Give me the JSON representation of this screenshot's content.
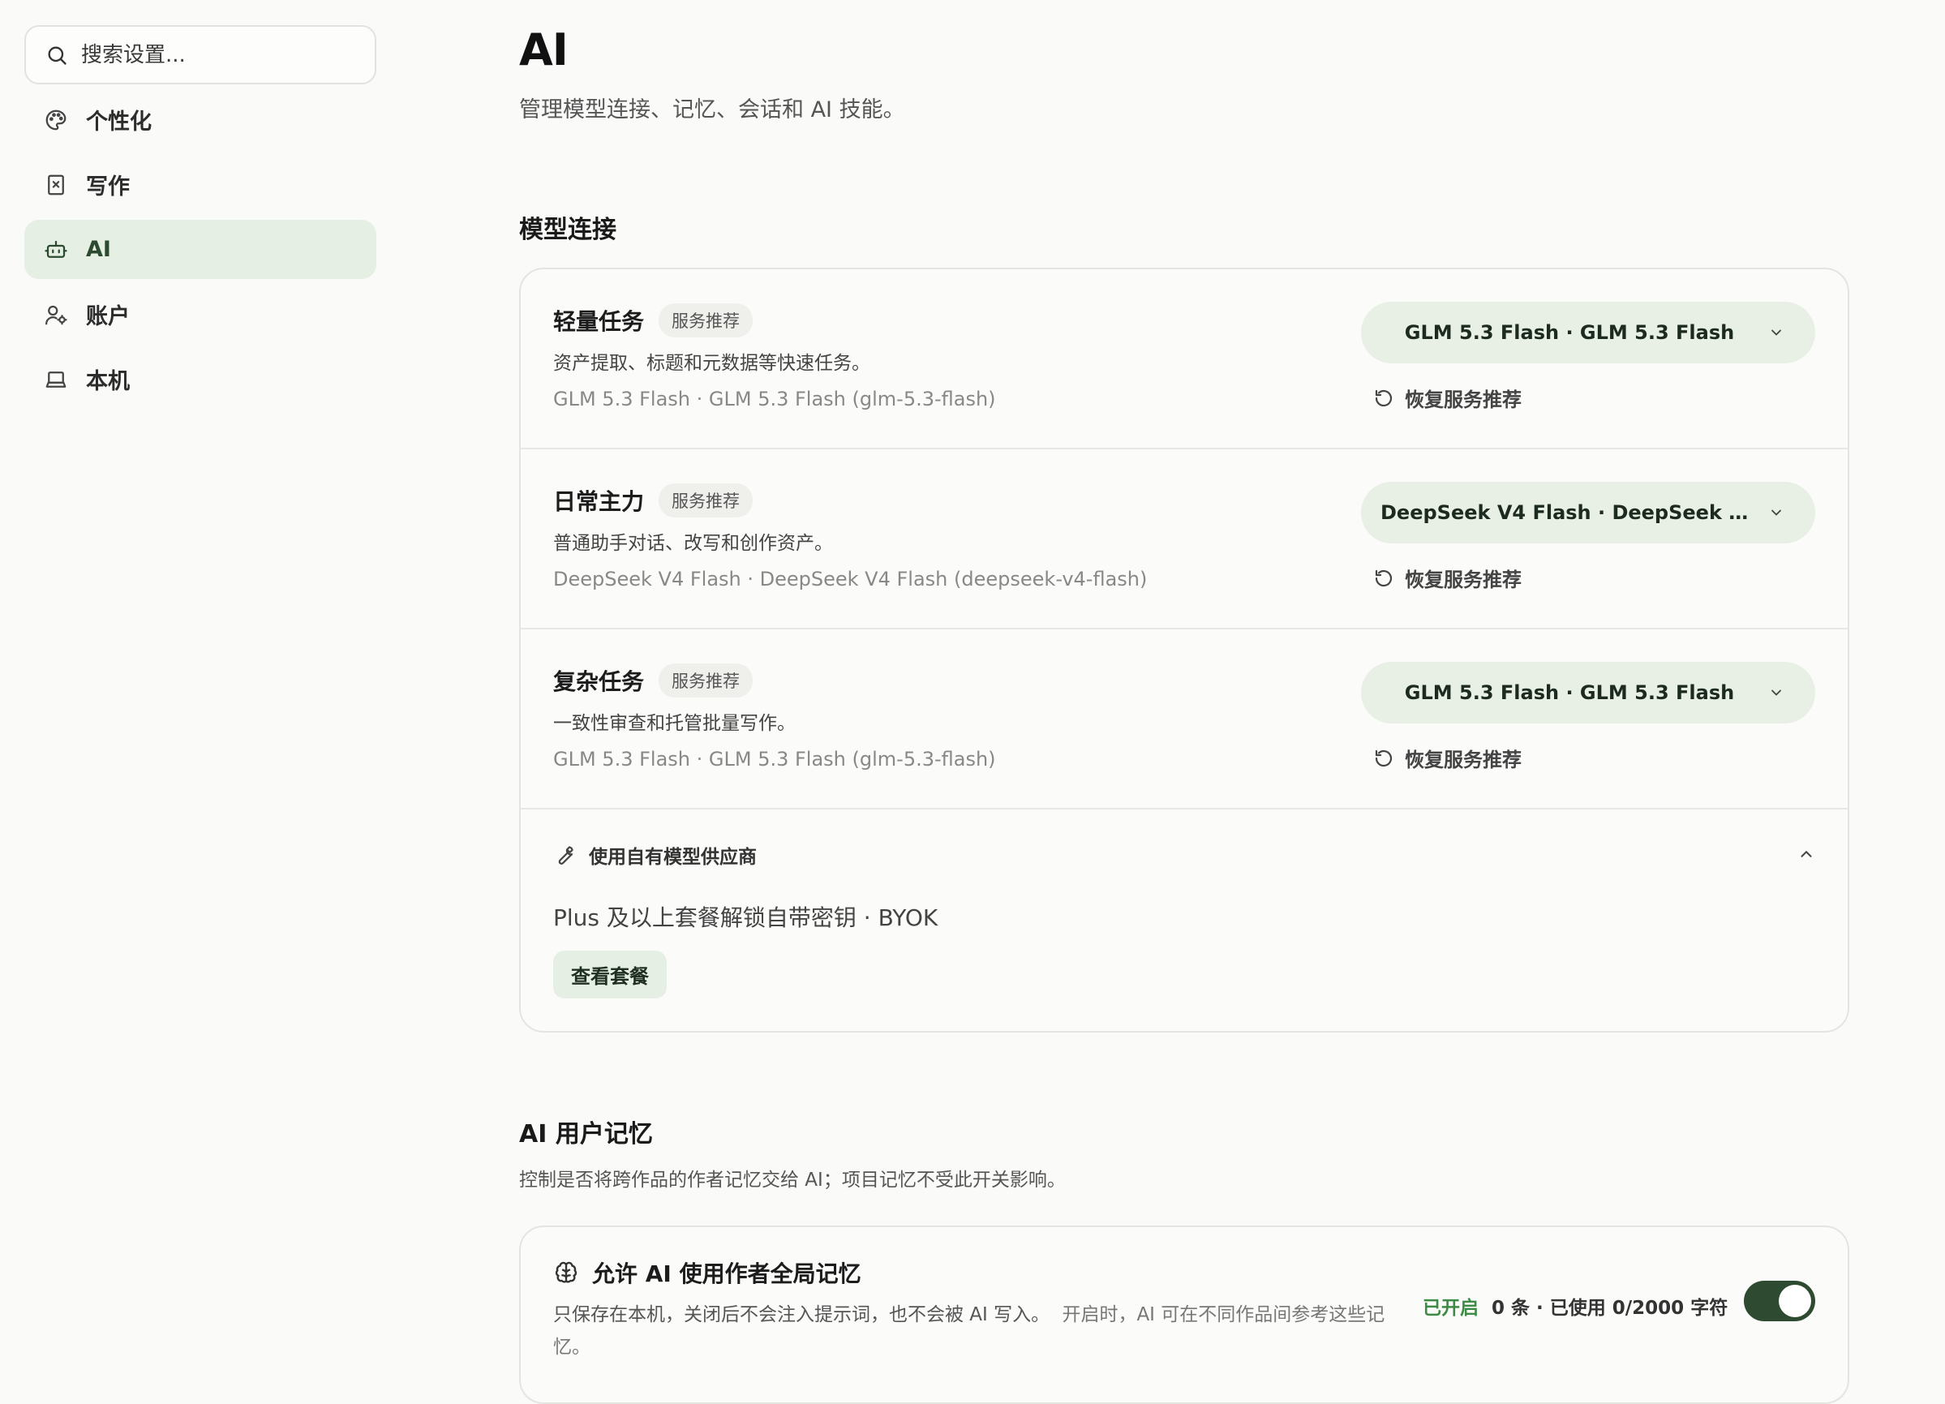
{
  "search": {
    "placeholder": "搜索设置..."
  },
  "sidebar": {
    "items": [
      {
        "label": "个性化",
        "icon": "palette-icon"
      },
      {
        "label": "写作",
        "icon": "book-icon"
      },
      {
        "label": "AI",
        "icon": "bot-icon",
        "active": true
      },
      {
        "label": "账户",
        "icon": "user-settings-icon"
      },
      {
        "label": "本机",
        "icon": "laptop-icon"
      }
    ]
  },
  "header": {
    "title": "AI",
    "subtitle": "管理模型连接、记忆、会话和 AI 技能。"
  },
  "model_section": {
    "title": "模型连接",
    "rows": [
      {
        "name": "轻量任务",
        "badge": "服务推荐",
        "description": "资产提取、标题和元数据等快速任务。",
        "model": "GLM 5.3 Flash · GLM 5.3 Flash (glm-5.3-flash)",
        "selected": "GLM 5.3 Flash · GLM 5.3 Flash",
        "restore_label": "恢复服务推荐"
      },
      {
        "name": "日常主力",
        "badge": "服务推荐",
        "description": "普通助手对话、改写和创作资产。",
        "model": "DeepSeek V4 Flash · DeepSeek V4 Flash (deepseek-v4-flash)",
        "selected": "DeepSeek V4 Flash · DeepSeek V4 Fl...",
        "restore_label": "恢复服务推荐"
      },
      {
        "name": "复杂任务",
        "badge": "服务推荐",
        "description": "一致性审查和托管批量写作。",
        "model": "GLM 5.3 Flash · GLM 5.3 Flash (glm-5.3-flash)",
        "selected": "GLM 5.3 Flash · GLM 5.3 Flash",
        "restore_label": "恢复服务推荐"
      }
    ],
    "byok": {
      "title": "使用自有模型供应商",
      "text": "Plus 及以上套餐解锁自带密钥 · BYOK",
      "button": "查看套餐"
    }
  },
  "memory_section": {
    "title": "AI 用户记忆",
    "subtitle": "控制是否将跨作品的作者记忆交给 AI；项目记忆不受此开关影响。",
    "card": {
      "title": "允许 AI 使用作者全局记忆",
      "description_main": "只保存在本机，关闭后不会注入提示词，也不会被 AI 写入。",
      "description_extra": "开启时，AI 可在不同作品间参考这些记忆。",
      "status": "已开启",
      "count": "0 条 · 已使用 0/2000 字符",
      "enabled": true
    }
  },
  "colors": {
    "accent": "#2e4a31",
    "accent_soft": "#e5efe3",
    "status_on": "#3c8a44"
  }
}
